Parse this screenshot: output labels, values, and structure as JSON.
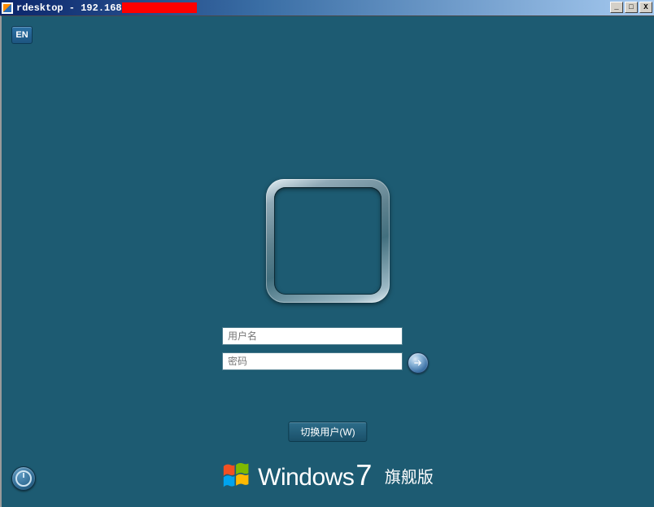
{
  "window": {
    "title_prefix": "rdesktop - 192.168",
    "controls": {
      "min": "_",
      "max": "□",
      "close": "X"
    }
  },
  "lang_indicator": "EN",
  "login": {
    "username_placeholder": "用户名",
    "password_placeholder": "密码",
    "switch_user_label": "切换用户(W)"
  },
  "branding": {
    "product": "Windows",
    "version": "7",
    "edition": "旗舰版"
  },
  "icons": {
    "submit": "arrow-right",
    "ease_of_access": "ease-of-access"
  }
}
